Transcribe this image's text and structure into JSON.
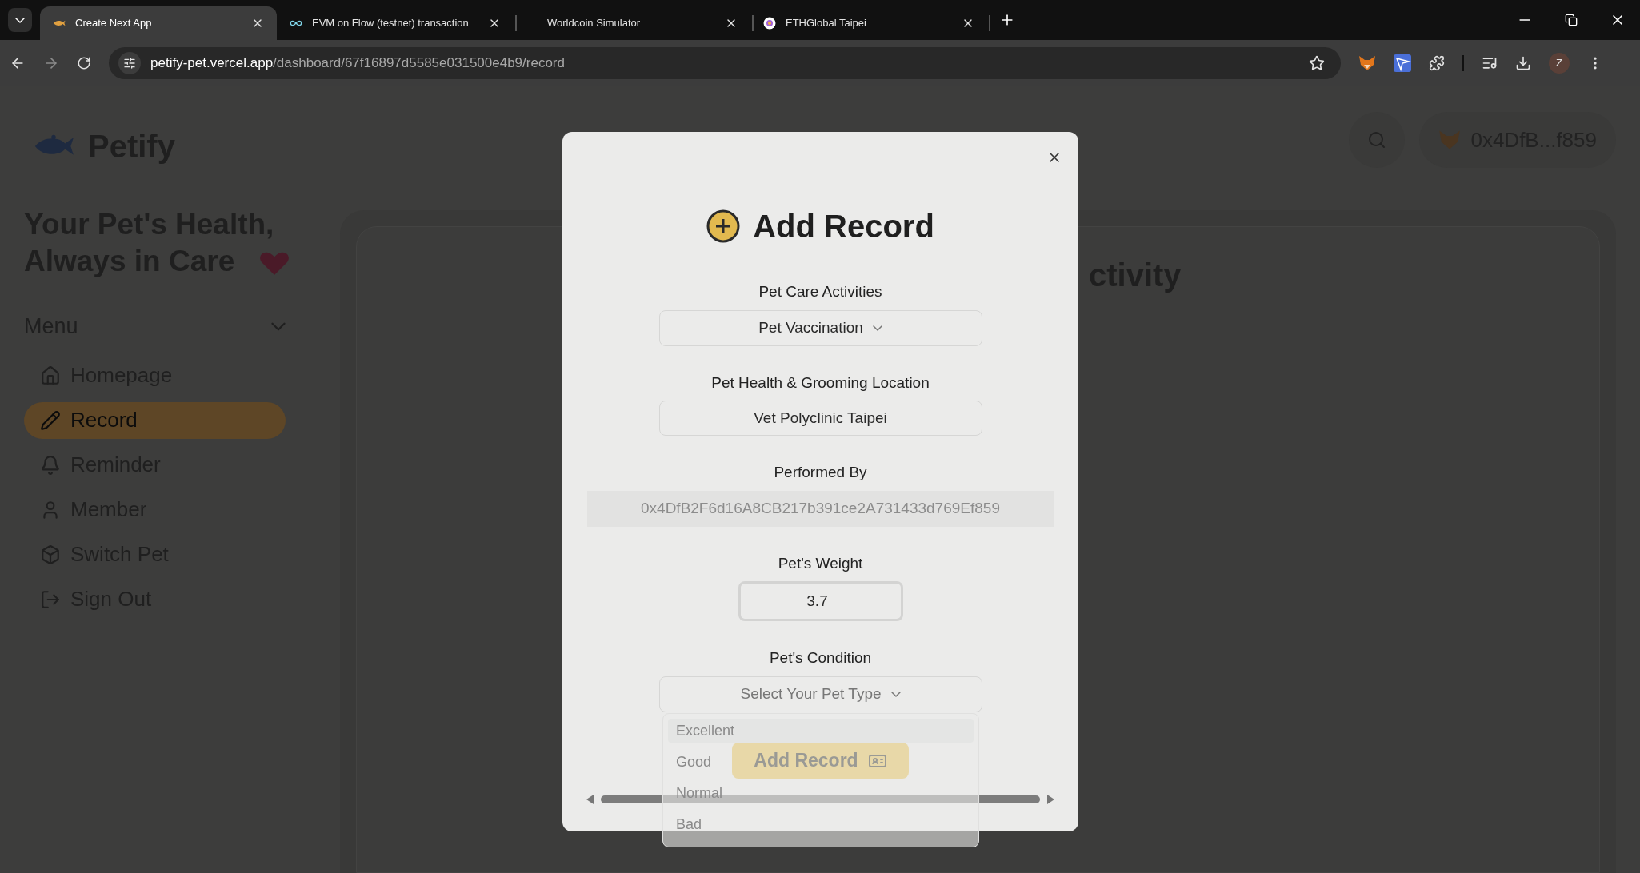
{
  "browser": {
    "tabs": [
      {
        "title": "Create Next App",
        "selected": true
      },
      {
        "title": "EVM on Flow (testnet) transaction",
        "selected": false
      },
      {
        "title": "Worldcoin Simulator",
        "selected": false
      },
      {
        "title": "ETHGlobal Taipei",
        "selected": false
      }
    ],
    "url": {
      "host": "petify-pet.vercel.app",
      "path": "/dashboard/67f16897d5585e031500e4b9/record"
    },
    "profile_initial": "Z"
  },
  "sidebar": {
    "logo": "Petify",
    "tagline": [
      "Your Pet's Health,",
      "Always in Care"
    ],
    "menu": {
      "title": "Menu",
      "expanded": true,
      "items": [
        {
          "label": "Homepage",
          "selected": false
        },
        {
          "label": "Record",
          "selected": true
        },
        {
          "label": "Reminder",
          "selected": false
        },
        {
          "label": "Member",
          "selected": false
        },
        {
          "label": "Switch Pet",
          "selected": false
        },
        {
          "label": "Sign Out",
          "selected": false
        }
      ]
    }
  },
  "header": {
    "wallet": "0x4DfB...f859"
  },
  "main": {
    "heading": "ctivity"
  },
  "modal": {
    "title": "Add Record",
    "fields": [
      {
        "kind": "select",
        "label": "Pet Care Activities",
        "value": "Pet Vaccination"
      },
      {
        "kind": "text",
        "label": "Pet Health & Grooming Location",
        "value": "Vet Polyclinic Taipei"
      },
      {
        "kind": "readonly",
        "label": "Performed By",
        "value": "0x4DfB2F6d16A8CB217b391ce2A731433d769Ef859"
      },
      {
        "kind": "number",
        "label": "Pet's Weight",
        "value": "3.7"
      },
      {
        "kind": "select",
        "label": "Pet's Condition",
        "placeholder": "Select Your Pet Type",
        "open": true,
        "options": [
          {
            "label": "Excellent",
            "selected": true
          },
          {
            "label": "Good",
            "selected": false
          },
          {
            "label": "Normal",
            "selected": false
          },
          {
            "label": "Bad",
            "selected": false
          }
        ]
      }
    ],
    "submit": "Add Record"
  }
}
